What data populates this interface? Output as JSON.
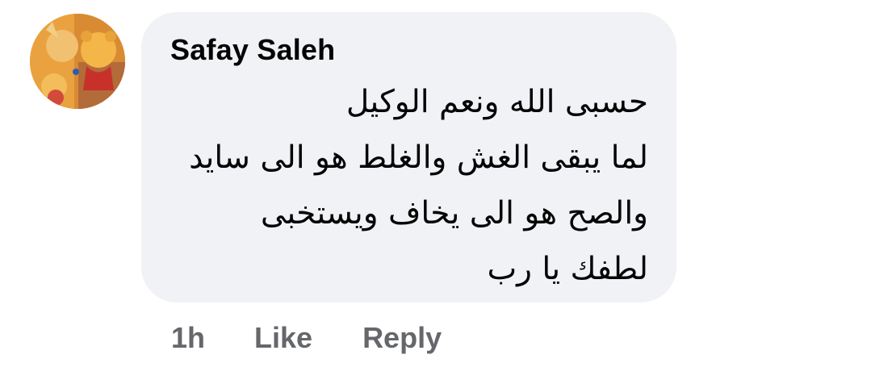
{
  "comment": {
    "author": "Safay Saleh",
    "lines": [
      "حسبى الله ونعم الوكيل",
      "لما يبقى الغش والغلط هو الى سايد",
      "والصح هو الى يخاف ويستخبى",
      "لطفك يا رب"
    ],
    "avatar_icon": "avatar-winnie-the-pooh-icon"
  },
  "actions": {
    "time": "1h",
    "like_label": "Like",
    "reply_label": "Reply"
  },
  "colors": {
    "bubble_bg": "#f0f2f5",
    "text": "#050505",
    "secondary_text": "#65676b"
  }
}
